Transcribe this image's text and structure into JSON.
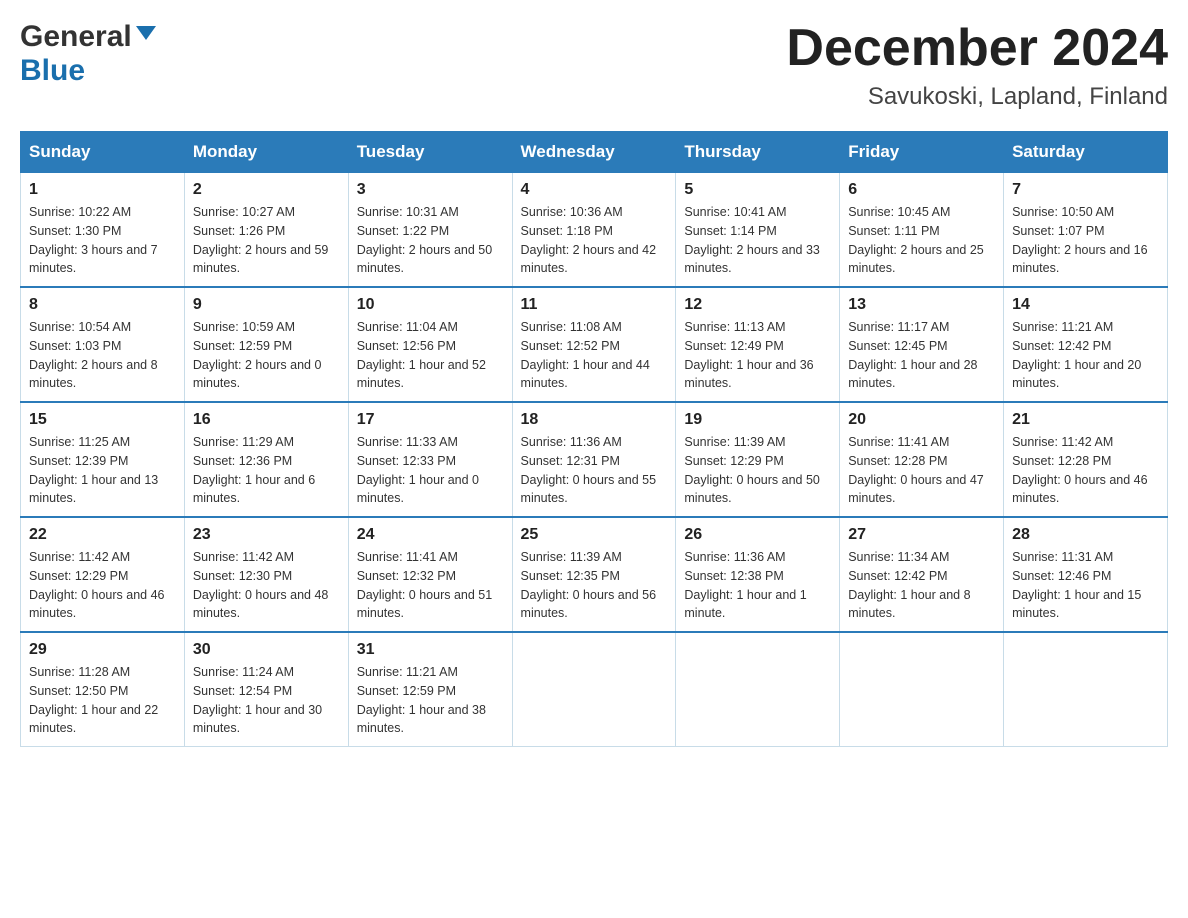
{
  "header": {
    "logo_general": "General",
    "logo_blue": "Blue",
    "month_title": "December 2024",
    "location": "Savukoski, Lapland, Finland"
  },
  "columns": [
    "Sunday",
    "Monday",
    "Tuesday",
    "Wednesday",
    "Thursday",
    "Friday",
    "Saturday"
  ],
  "weeks": [
    [
      {
        "day": "1",
        "sunrise": "Sunrise: 10:22 AM",
        "sunset": "Sunset: 1:30 PM",
        "daylight": "Daylight: 3 hours and 7 minutes."
      },
      {
        "day": "2",
        "sunrise": "Sunrise: 10:27 AM",
        "sunset": "Sunset: 1:26 PM",
        "daylight": "Daylight: 2 hours and 59 minutes."
      },
      {
        "day": "3",
        "sunrise": "Sunrise: 10:31 AM",
        "sunset": "Sunset: 1:22 PM",
        "daylight": "Daylight: 2 hours and 50 minutes."
      },
      {
        "day": "4",
        "sunrise": "Sunrise: 10:36 AM",
        "sunset": "Sunset: 1:18 PM",
        "daylight": "Daylight: 2 hours and 42 minutes."
      },
      {
        "day": "5",
        "sunrise": "Sunrise: 10:41 AM",
        "sunset": "Sunset: 1:14 PM",
        "daylight": "Daylight: 2 hours and 33 minutes."
      },
      {
        "day": "6",
        "sunrise": "Sunrise: 10:45 AM",
        "sunset": "Sunset: 1:11 PM",
        "daylight": "Daylight: 2 hours and 25 minutes."
      },
      {
        "day": "7",
        "sunrise": "Sunrise: 10:50 AM",
        "sunset": "Sunset: 1:07 PM",
        "daylight": "Daylight: 2 hours and 16 minutes."
      }
    ],
    [
      {
        "day": "8",
        "sunrise": "Sunrise: 10:54 AM",
        "sunset": "Sunset: 1:03 PM",
        "daylight": "Daylight: 2 hours and 8 minutes."
      },
      {
        "day": "9",
        "sunrise": "Sunrise: 10:59 AM",
        "sunset": "Sunset: 12:59 PM",
        "daylight": "Daylight: 2 hours and 0 minutes."
      },
      {
        "day": "10",
        "sunrise": "Sunrise: 11:04 AM",
        "sunset": "Sunset: 12:56 PM",
        "daylight": "Daylight: 1 hour and 52 minutes."
      },
      {
        "day": "11",
        "sunrise": "Sunrise: 11:08 AM",
        "sunset": "Sunset: 12:52 PM",
        "daylight": "Daylight: 1 hour and 44 minutes."
      },
      {
        "day": "12",
        "sunrise": "Sunrise: 11:13 AM",
        "sunset": "Sunset: 12:49 PM",
        "daylight": "Daylight: 1 hour and 36 minutes."
      },
      {
        "day": "13",
        "sunrise": "Sunrise: 11:17 AM",
        "sunset": "Sunset: 12:45 PM",
        "daylight": "Daylight: 1 hour and 28 minutes."
      },
      {
        "day": "14",
        "sunrise": "Sunrise: 11:21 AM",
        "sunset": "Sunset: 12:42 PM",
        "daylight": "Daylight: 1 hour and 20 minutes."
      }
    ],
    [
      {
        "day": "15",
        "sunrise": "Sunrise: 11:25 AM",
        "sunset": "Sunset: 12:39 PM",
        "daylight": "Daylight: 1 hour and 13 minutes."
      },
      {
        "day": "16",
        "sunrise": "Sunrise: 11:29 AM",
        "sunset": "Sunset: 12:36 PM",
        "daylight": "Daylight: 1 hour and 6 minutes."
      },
      {
        "day": "17",
        "sunrise": "Sunrise: 11:33 AM",
        "sunset": "Sunset: 12:33 PM",
        "daylight": "Daylight: 1 hour and 0 minutes."
      },
      {
        "day": "18",
        "sunrise": "Sunrise: 11:36 AM",
        "sunset": "Sunset: 12:31 PM",
        "daylight": "Daylight: 0 hours and 55 minutes."
      },
      {
        "day": "19",
        "sunrise": "Sunrise: 11:39 AM",
        "sunset": "Sunset: 12:29 PM",
        "daylight": "Daylight: 0 hours and 50 minutes."
      },
      {
        "day": "20",
        "sunrise": "Sunrise: 11:41 AM",
        "sunset": "Sunset: 12:28 PM",
        "daylight": "Daylight: 0 hours and 47 minutes."
      },
      {
        "day": "21",
        "sunrise": "Sunrise: 11:42 AM",
        "sunset": "Sunset: 12:28 PM",
        "daylight": "Daylight: 0 hours and 46 minutes."
      }
    ],
    [
      {
        "day": "22",
        "sunrise": "Sunrise: 11:42 AM",
        "sunset": "Sunset: 12:29 PM",
        "daylight": "Daylight: 0 hours and 46 minutes."
      },
      {
        "day": "23",
        "sunrise": "Sunrise: 11:42 AM",
        "sunset": "Sunset: 12:30 PM",
        "daylight": "Daylight: 0 hours and 48 minutes."
      },
      {
        "day": "24",
        "sunrise": "Sunrise: 11:41 AM",
        "sunset": "Sunset: 12:32 PM",
        "daylight": "Daylight: 0 hours and 51 minutes."
      },
      {
        "day": "25",
        "sunrise": "Sunrise: 11:39 AM",
        "sunset": "Sunset: 12:35 PM",
        "daylight": "Daylight: 0 hours and 56 minutes."
      },
      {
        "day": "26",
        "sunrise": "Sunrise: 11:36 AM",
        "sunset": "Sunset: 12:38 PM",
        "daylight": "Daylight: 1 hour and 1 minute."
      },
      {
        "day": "27",
        "sunrise": "Sunrise: 11:34 AM",
        "sunset": "Sunset: 12:42 PM",
        "daylight": "Daylight: 1 hour and 8 minutes."
      },
      {
        "day": "28",
        "sunrise": "Sunrise: 11:31 AM",
        "sunset": "Sunset: 12:46 PM",
        "daylight": "Daylight: 1 hour and 15 minutes."
      }
    ],
    [
      {
        "day": "29",
        "sunrise": "Sunrise: 11:28 AM",
        "sunset": "Sunset: 12:50 PM",
        "daylight": "Daylight: 1 hour and 22 minutes."
      },
      {
        "day": "30",
        "sunrise": "Sunrise: 11:24 AM",
        "sunset": "Sunset: 12:54 PM",
        "daylight": "Daylight: 1 hour and 30 minutes."
      },
      {
        "day": "31",
        "sunrise": "Sunrise: 11:21 AM",
        "sunset": "Sunset: 12:59 PM",
        "daylight": "Daylight: 1 hour and 38 minutes."
      },
      null,
      null,
      null,
      null
    ]
  ]
}
